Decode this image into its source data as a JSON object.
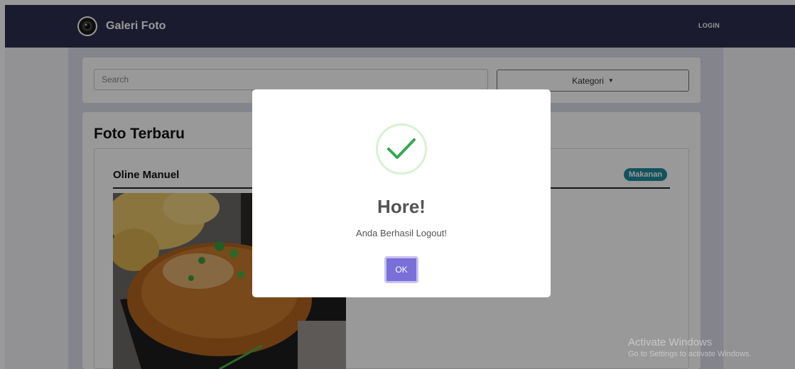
{
  "navbar": {
    "brand": "Galeri Foto",
    "login": "LOGIN"
  },
  "search": {
    "placeholder": "Search",
    "kategori": "Kategori"
  },
  "main": {
    "section_title": "Foto Terbaru",
    "post": {
      "author": "Oline Manuel",
      "category": "Makanan"
    }
  },
  "modal": {
    "title": "Hore!",
    "message": "Anda Berhasil Logout!",
    "ok": "OK",
    "icon": "check-icon",
    "icon_color": "#34a853"
  },
  "watermark": {
    "title": "Activate Windows",
    "subtitle": "Go to Settings to activate Windows."
  },
  "colors": {
    "navbar": "#2c2d4f",
    "badge": "#1f8a9b",
    "ok_button": "#7a6fd8"
  }
}
